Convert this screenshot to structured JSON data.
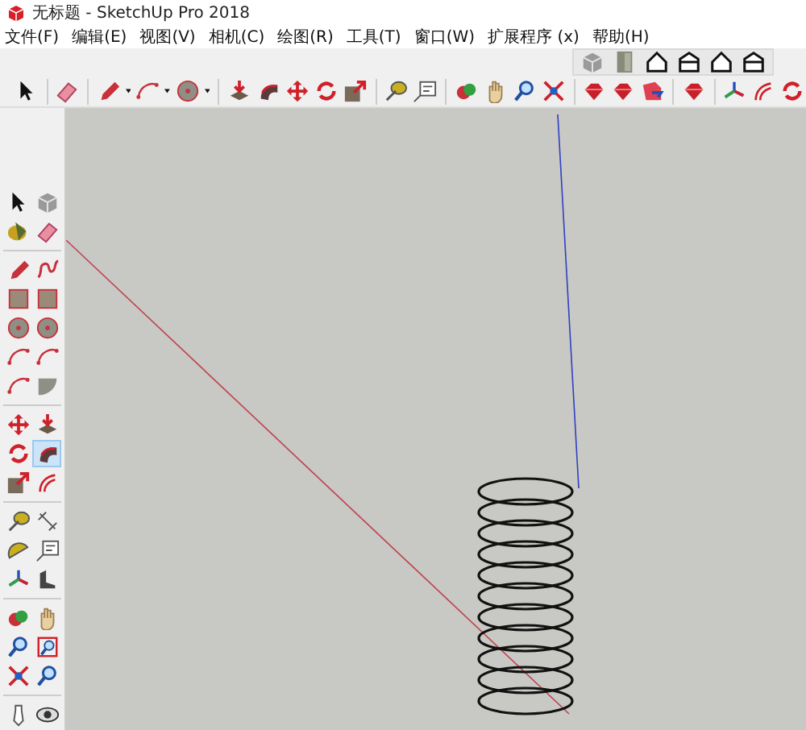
{
  "window": {
    "title": "无标题 - SketchUp Pro 2018"
  },
  "menu": [
    "文件(F)",
    "编辑(E)",
    "视图(V)",
    "相机(C)",
    "绘图(R)",
    "工具(T)",
    "窗口(W)",
    "扩展程序 (x)",
    "帮助(H)"
  ],
  "left_toolbar": [
    {
      "selected": false
    },
    {
      "selected": false
    },
    {
      "selected": false
    },
    {
      "selected": false
    },
    {
      "selected": false
    },
    {
      "selected": false
    },
    {
      "selected": false
    },
    {
      "selected": false
    },
    {
      "selected": false
    },
    {
      "selected": false
    },
    {
      "selected": false
    },
    {
      "selected": false
    },
    {
      "selected": false
    },
    {
      "selected": false
    },
    {
      "selected": false
    },
    {
      "selected": false
    },
    {
      "selected": false
    },
    {
      "selected": true
    },
    {
      "selected": false
    },
    {
      "selected": false
    },
    {
      "selected": false
    },
    {
      "selected": false
    },
    {
      "selected": false
    },
    {
      "selected": false
    },
    {
      "selected": false
    },
    {
      "selected": false
    },
    {
      "selected": false
    },
    {
      "selected": false
    },
    {
      "selected": false
    },
    {
      "selected": false
    },
    {
      "selected": false
    },
    {
      "selected": false
    },
    {
      "selected": false
    },
    {
      "selected": false
    }
  ]
}
